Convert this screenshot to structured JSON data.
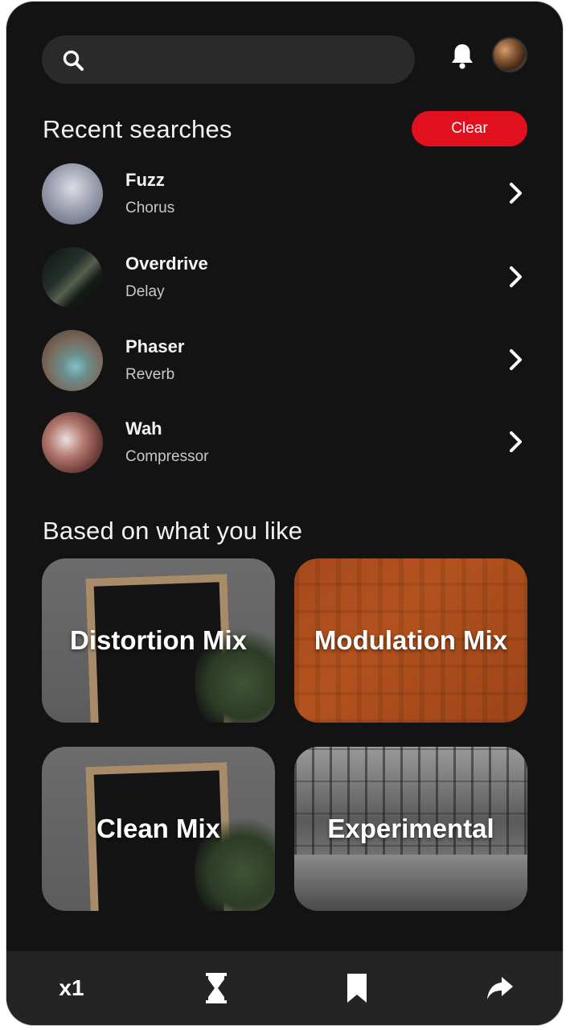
{
  "search": {
    "placeholder": "",
    "icon": "search-icon"
  },
  "header": {
    "bell_icon": "bell-icon",
    "avatar_icon": "avatar"
  },
  "recent": {
    "title": "Recent searches",
    "clear_label": "Clear",
    "items": [
      {
        "title": "Fuzz",
        "subtitle": "Chorus"
      },
      {
        "title": "Overdrive",
        "subtitle": "Delay"
      },
      {
        "title": "Phaser",
        "subtitle": "Reverb"
      },
      {
        "title": "Wah",
        "subtitle": "Compressor"
      }
    ]
  },
  "liked": {
    "title": "Based on what you like",
    "cards": [
      {
        "label": "Distortion Mix"
      },
      {
        "label": "Modulation Mix"
      },
      {
        "label": "Clean Mix"
      },
      {
        "label": "Experimental"
      }
    ]
  },
  "bottom_bar": {
    "speed_label": "x1",
    "icons": [
      "hourglass-icon",
      "bookmark-icon",
      "share-icon"
    ]
  },
  "colors": {
    "background": "#131313",
    "accent": "#e0101e",
    "surface": "#2a2a2a",
    "bar": "#242424"
  }
}
